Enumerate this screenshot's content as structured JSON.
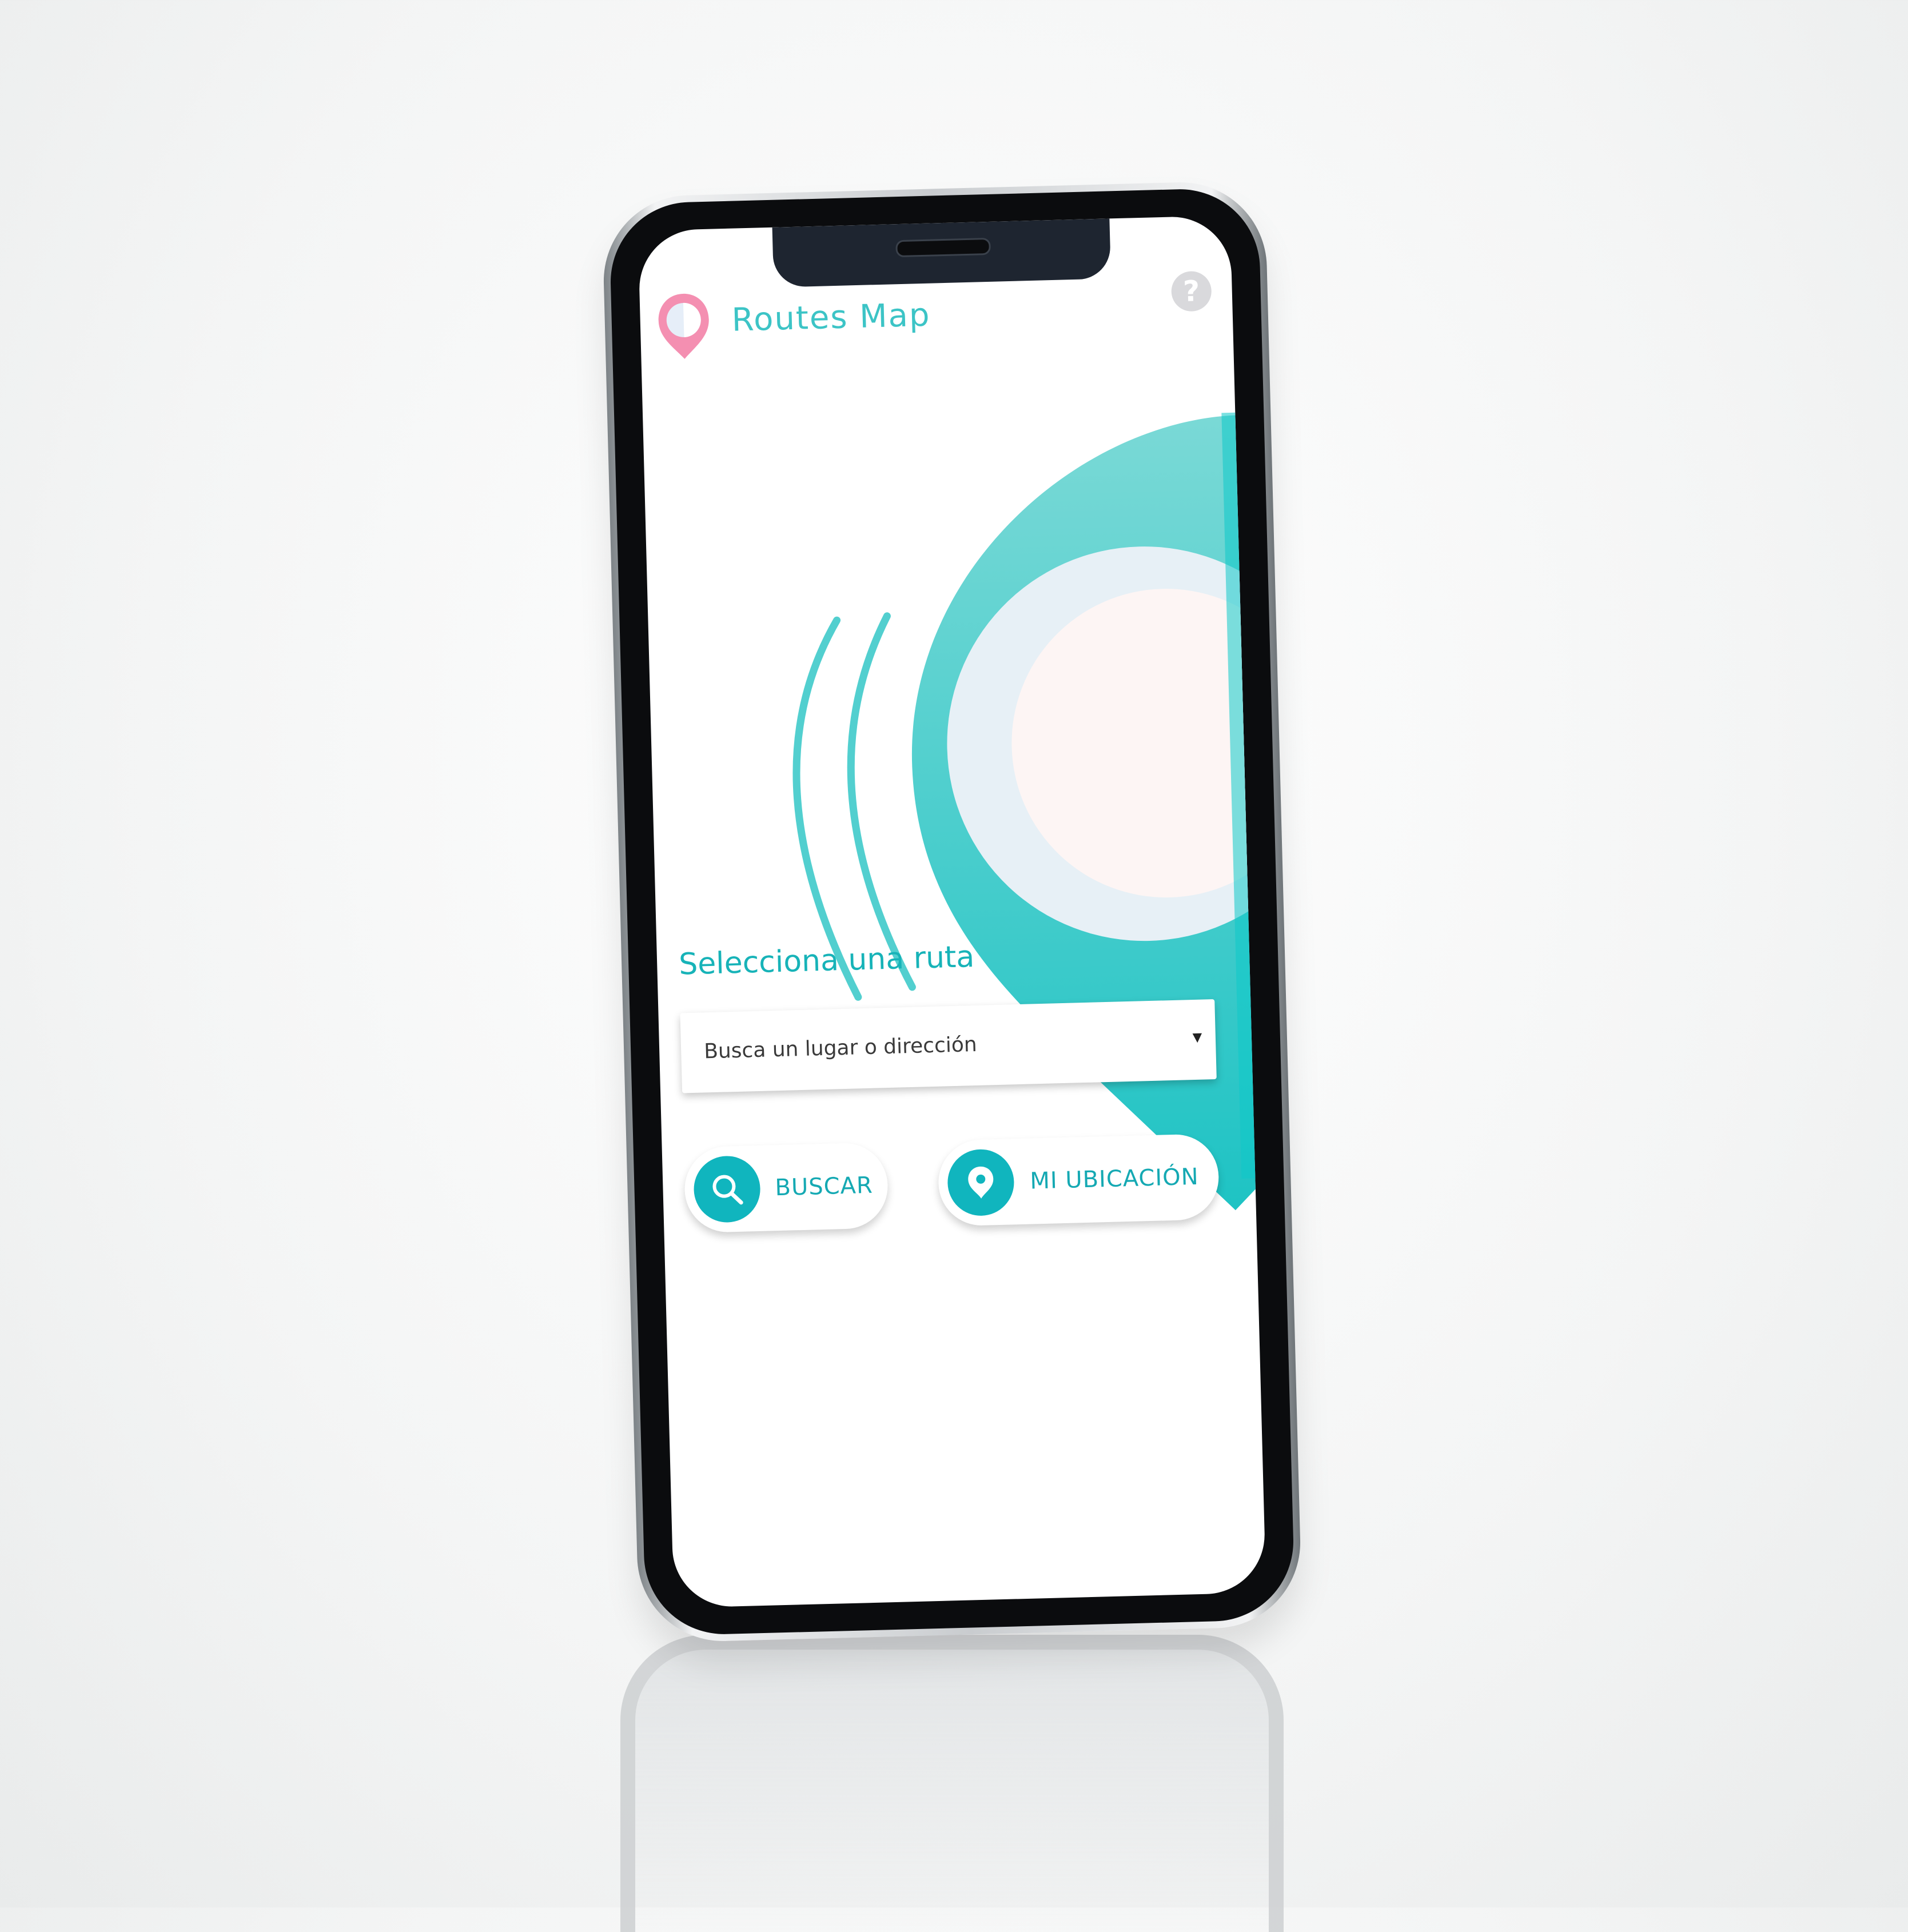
{
  "header": {
    "title": "Routes Map",
    "logo_icon": "map-pin-icon",
    "help_icon": "question-icon",
    "help_glyph": "?"
  },
  "main": {
    "heading": "Selecciona una ruta",
    "search": {
      "value": "Busca un lugar o dirección",
      "arrow_glyph": "▼"
    },
    "buttons": {
      "search_label": "BUSCAR",
      "location_label": "MI UBICACIÓN"
    }
  },
  "colors": {
    "accent": "#10b5be",
    "title": "#3cc4c6",
    "logo": "#f48fb1"
  },
  "icons": [
    "map-pin-icon",
    "question-icon",
    "search-icon",
    "location-pin-icon",
    "chevron-down-icon"
  ]
}
